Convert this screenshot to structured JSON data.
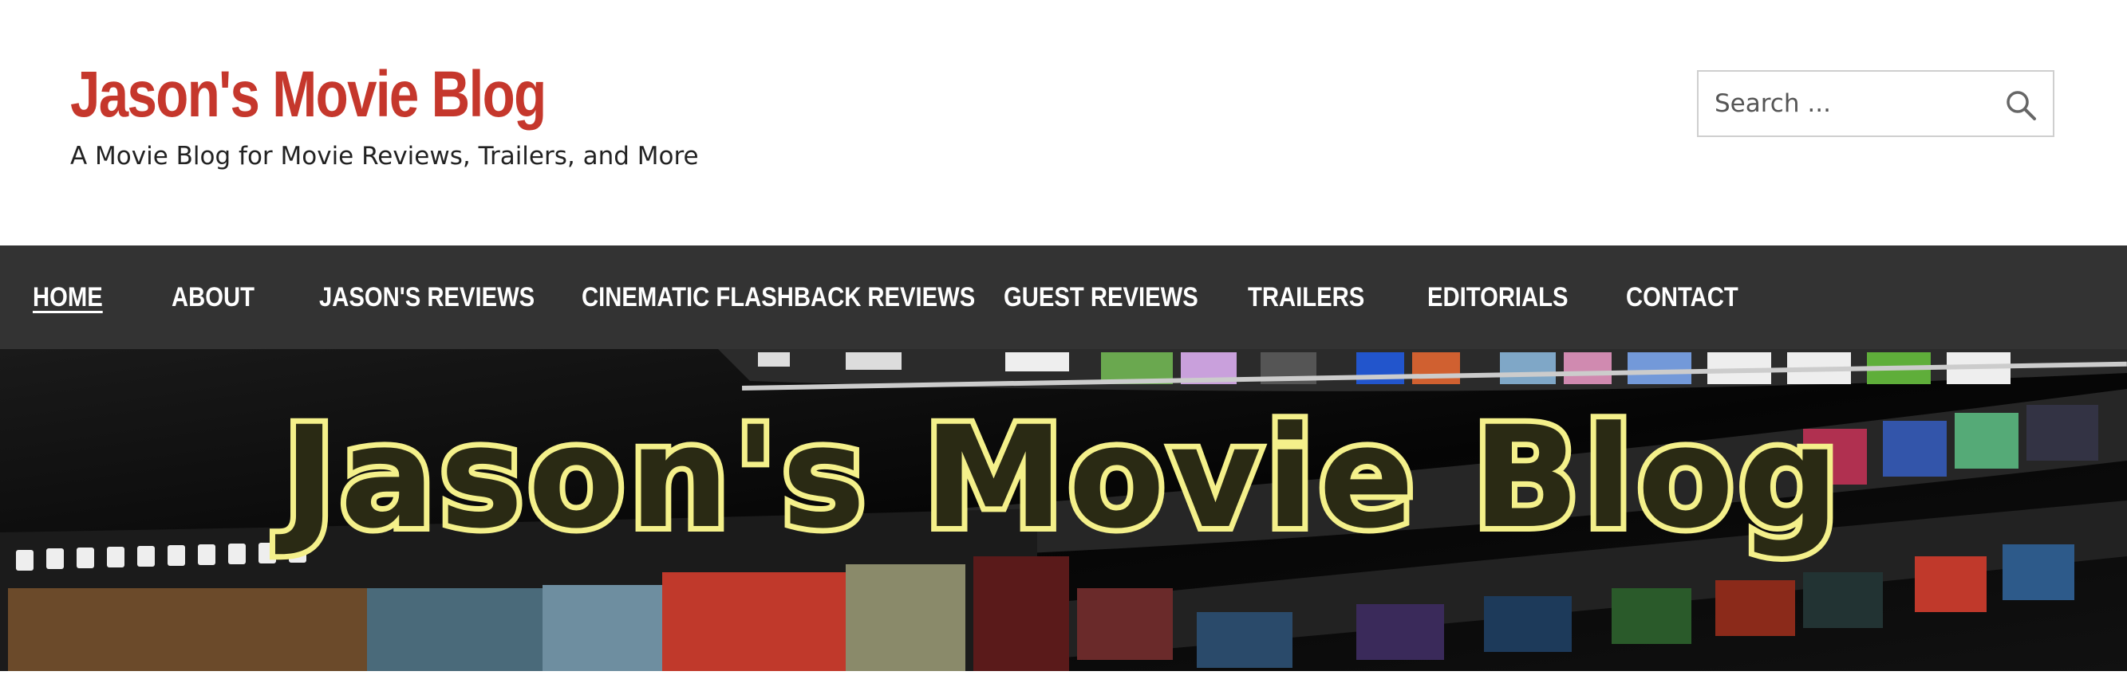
{
  "site": {
    "title": "Jason's Movie Blog",
    "tagline": "A Movie Blog for Movie Reviews, Trailers, and More"
  },
  "search": {
    "placeholder": "Search ...",
    "button_icon": "search-icon"
  },
  "nav": {
    "items": [
      {
        "label": "HOME",
        "current": true
      },
      {
        "label": "ABOUT"
      },
      {
        "label": "JASON'S REVIEWS"
      },
      {
        "label": "CINEMATIC FLASHBACK REVIEWS"
      },
      {
        "label": "GUEST REVIEWS"
      },
      {
        "label": "TRAILERS"
      },
      {
        "label": "EDITORIALS"
      },
      {
        "label": "CONTACT"
      }
    ]
  },
  "banner": {
    "text": "Jason's Movie Blog"
  },
  "colors": {
    "title": "#c5372c",
    "nav_bg": "#333333",
    "nav_text": "#ffffff",
    "banner_text_fill": "#2a2a14",
    "banner_text_stroke": "#f4f08a"
  }
}
